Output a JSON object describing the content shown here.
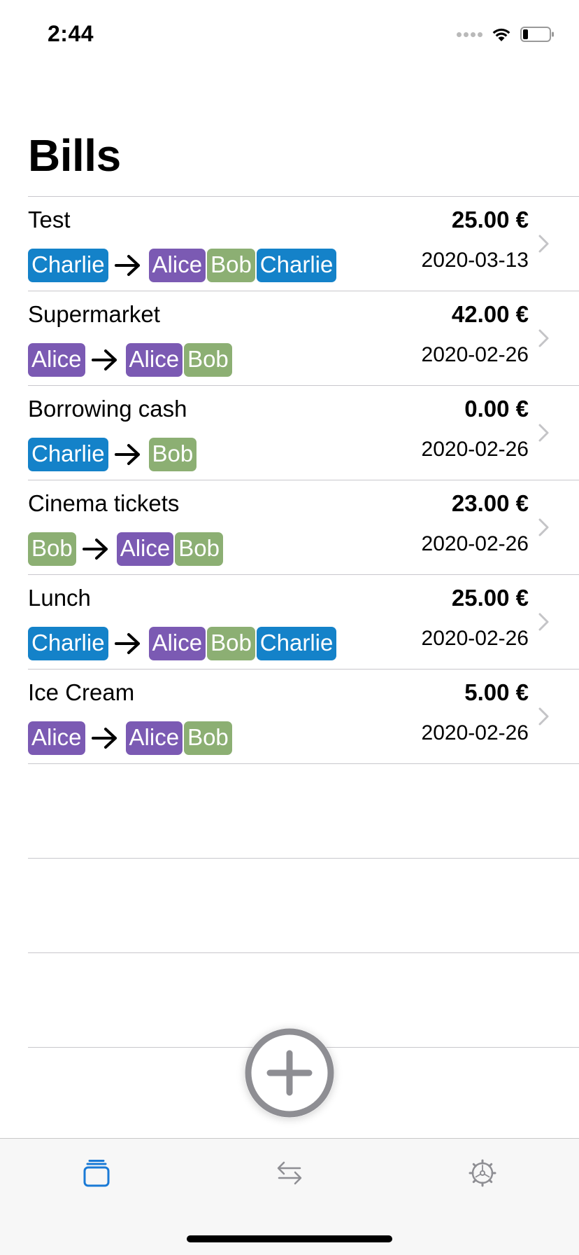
{
  "status_bar": {
    "time": "2:44"
  },
  "page": {
    "title": "Bills"
  },
  "bills": [
    {
      "name": "Test",
      "amount": "25.00 €",
      "date": "2020-03-13",
      "payer": "Charlie",
      "participants": [
        "Alice",
        "Bob",
        "Charlie"
      ]
    },
    {
      "name": "Supermarket",
      "amount": "42.00 €",
      "date": "2020-02-26",
      "payer": "Alice",
      "participants": [
        "Alice",
        "Bob"
      ]
    },
    {
      "name": "Borrowing cash",
      "amount": "0.00 €",
      "date": "2020-02-26",
      "payer": "Charlie",
      "participants": [
        "Bob"
      ]
    },
    {
      "name": "Cinema tickets",
      "amount": "23.00 €",
      "date": "2020-02-26",
      "payer": "Bob",
      "participants": [
        "Alice",
        "Bob"
      ]
    },
    {
      "name": "Lunch",
      "amount": "25.00 €",
      "date": "2020-02-26",
      "payer": "Charlie",
      "participants": [
        "Alice",
        "Bob",
        "Charlie"
      ]
    },
    {
      "name": "Ice Cream",
      "amount": "5.00 €",
      "date": "2020-02-26",
      "payer": "Alice",
      "participants": [
        "Alice",
        "Bob"
      ]
    }
  ],
  "person_colors": {
    "Alice": "#7b5ab3",
    "Bob": "#8caf73",
    "Charlie": "#1482c9"
  },
  "fab": {
    "icon": "plus-circle-icon"
  },
  "tabs": [
    {
      "id": "bills",
      "icon": "cards-stack-icon",
      "active": true,
      "color": "#1a7ad6"
    },
    {
      "id": "transfers",
      "icon": "arrows-exchange-icon",
      "active": false,
      "color": "#8e8e93"
    },
    {
      "id": "settings",
      "icon": "gear-icon",
      "active": false,
      "color": "#8e8e93"
    }
  ],
  "colors": {
    "accent": "#1a7ad6",
    "separator": "#c8c7cc",
    "tab_bar_bg": "#f7f7f7"
  }
}
